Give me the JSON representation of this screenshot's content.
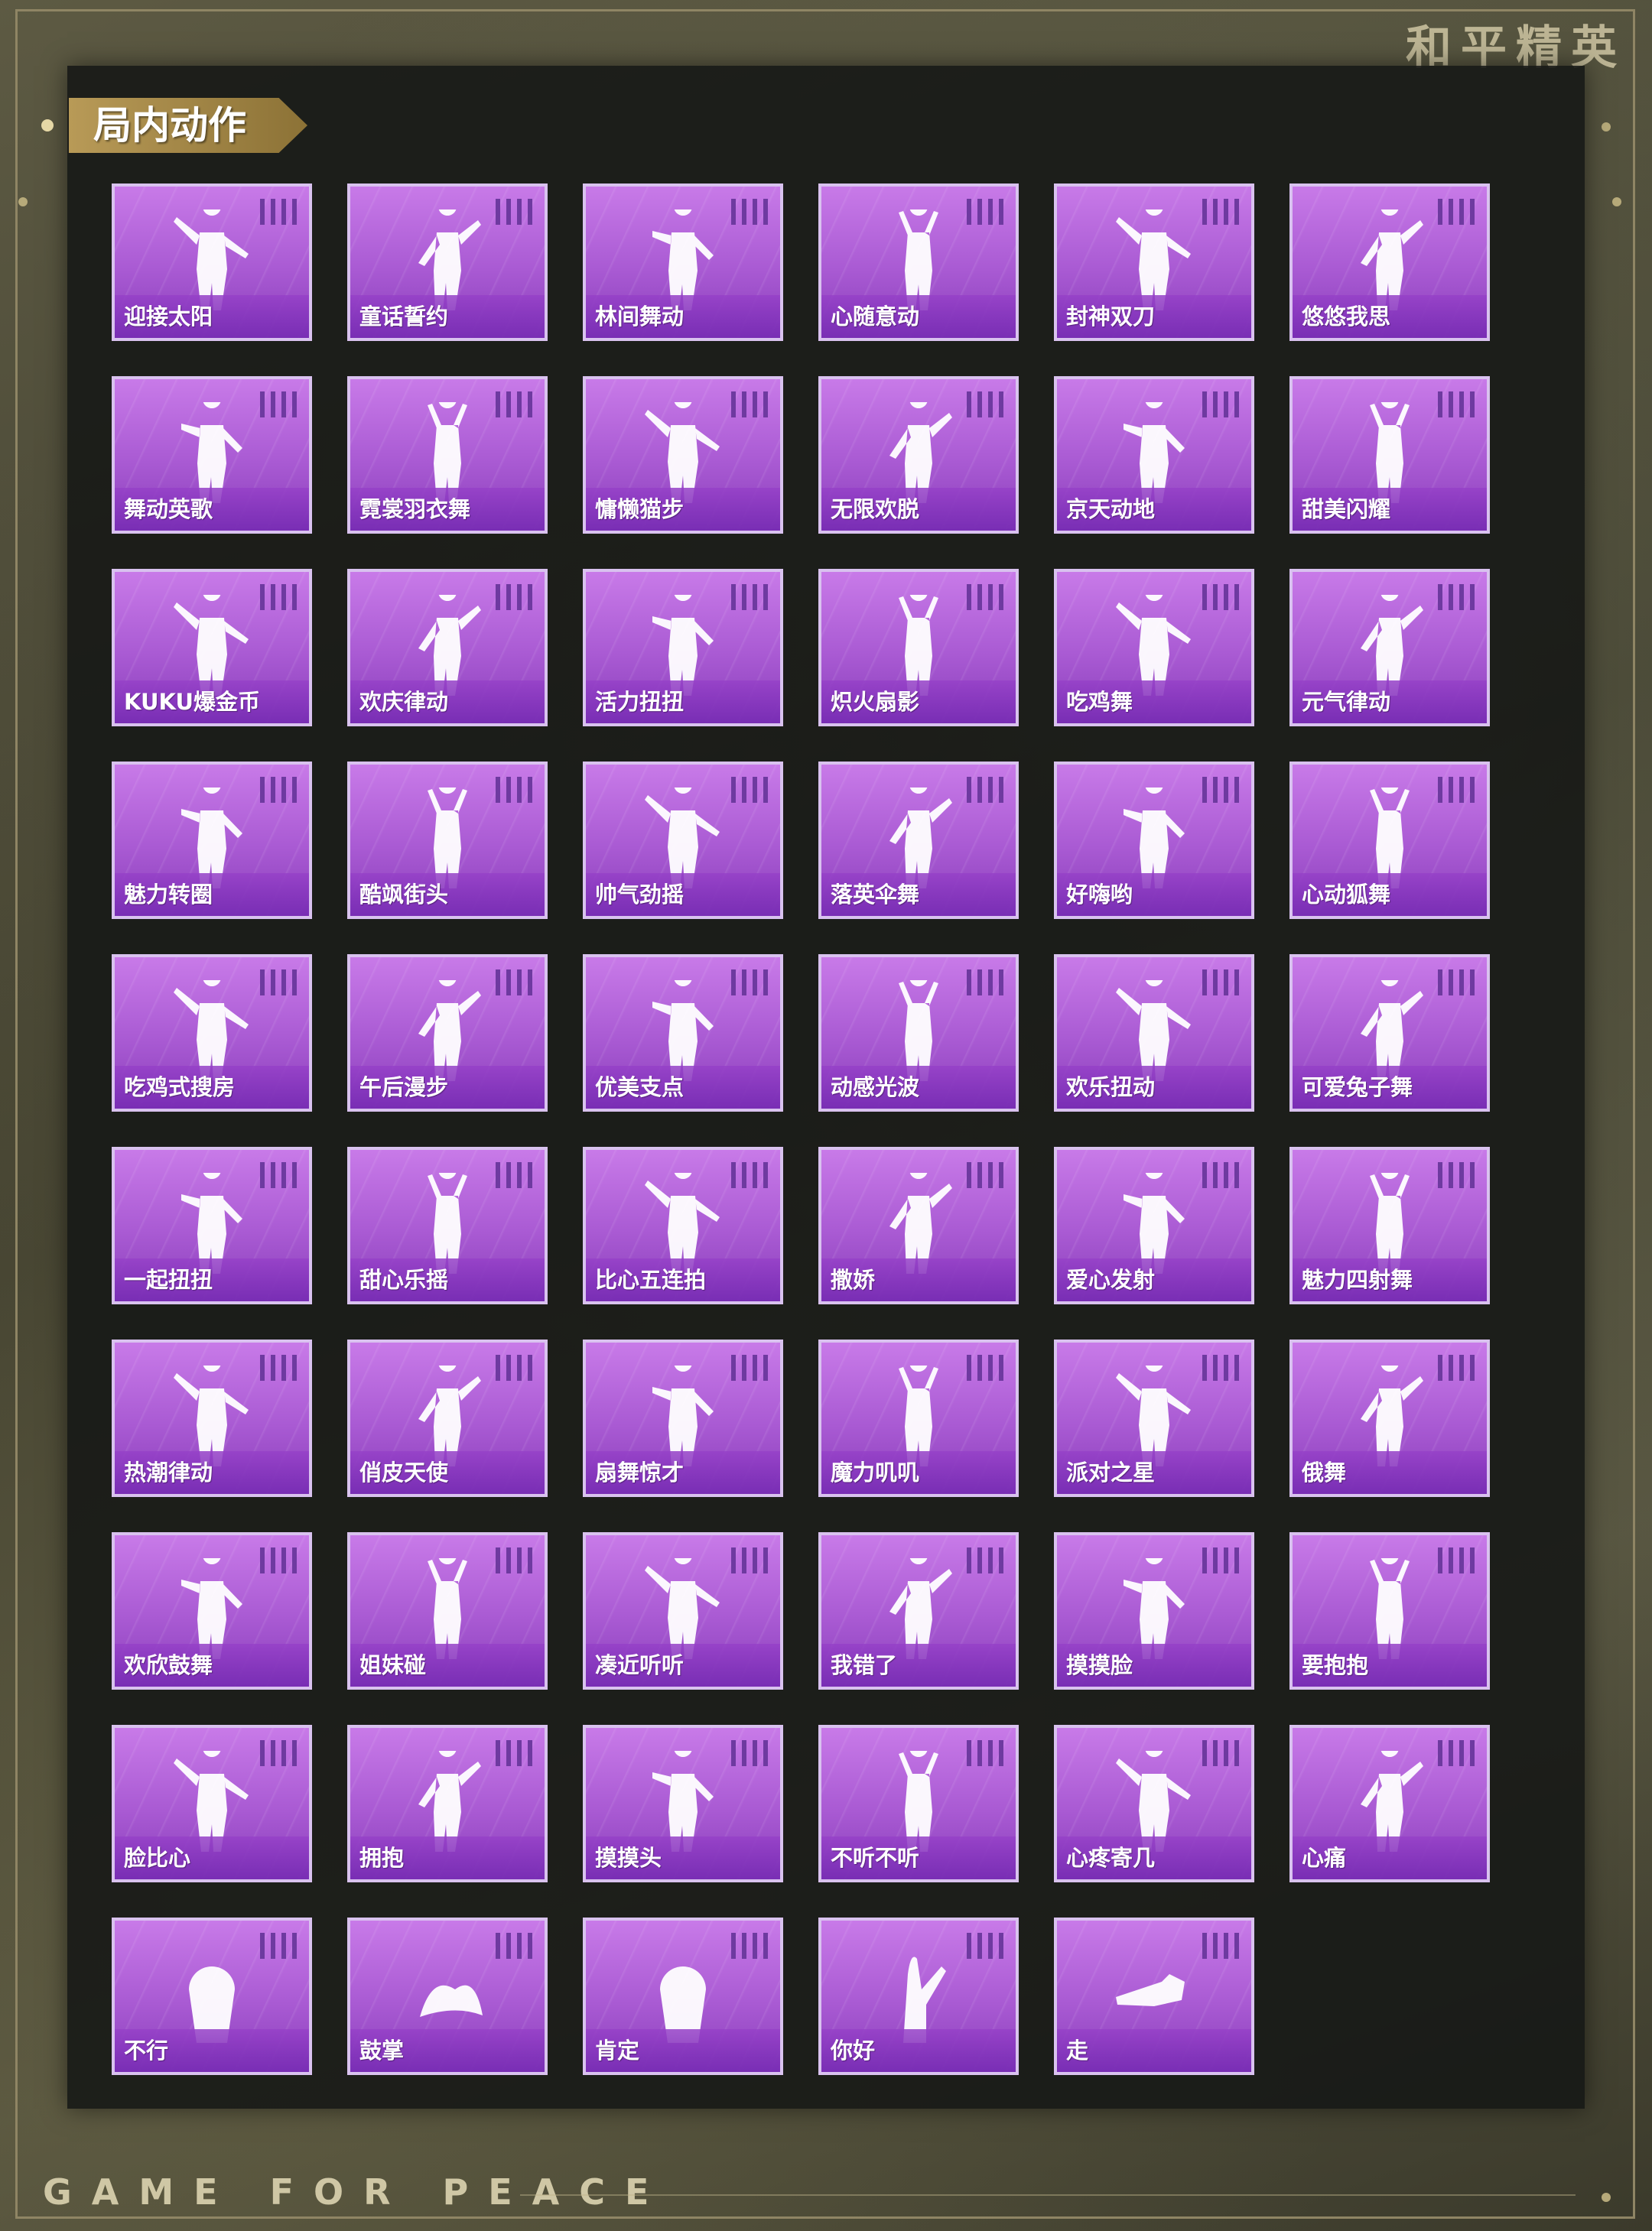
{
  "brand": {
    "logo_text": "和平精英"
  },
  "footer": {
    "slogan": "GAME FOR PEACE"
  },
  "section": {
    "title": "局内动作"
  },
  "emotes": [
    {
      "label": "迎接太阳",
      "icon": "dance-pose-icon"
    },
    {
      "label": "童话誓约",
      "icon": "dance-pose-icon"
    },
    {
      "label": "林间舞动",
      "icon": "dance-pose-icon"
    },
    {
      "label": "心随意动",
      "icon": "dance-pose-icon"
    },
    {
      "label": "封神双刀",
      "icon": "dance-pose-icon"
    },
    {
      "label": "悠悠我思",
      "icon": "dance-pose-icon"
    },
    {
      "label": "舞动英歌",
      "icon": "dance-pose-icon"
    },
    {
      "label": "霓裳羽衣舞",
      "icon": "dance-pose-icon"
    },
    {
      "label": "慵懒猫步",
      "icon": "dance-pose-icon"
    },
    {
      "label": "无限欢脱",
      "icon": "dance-pose-icon"
    },
    {
      "label": "京天动地",
      "icon": "dance-pose-icon"
    },
    {
      "label": "甜美闪耀",
      "icon": "dance-pose-icon"
    },
    {
      "label": "KUKU爆金币",
      "icon": "dance-pose-icon"
    },
    {
      "label": "欢庆律动",
      "icon": "dance-pose-icon"
    },
    {
      "label": "活力扭扭",
      "icon": "dance-pose-icon"
    },
    {
      "label": "炽火扇影",
      "icon": "dance-pose-icon"
    },
    {
      "label": "吃鸡舞",
      "icon": "dance-pose-icon"
    },
    {
      "label": "元气律动",
      "icon": "dance-pose-icon"
    },
    {
      "label": "魅力转圈",
      "icon": "dance-pose-icon"
    },
    {
      "label": "酷飒街头",
      "icon": "dance-pose-icon"
    },
    {
      "label": "帅气劲摇",
      "icon": "dance-pose-icon"
    },
    {
      "label": "落英伞舞",
      "icon": "dance-pose-icon"
    },
    {
      "label": "好嗨哟",
      "icon": "dance-pose-icon"
    },
    {
      "label": "心动狐舞",
      "icon": "dance-pose-icon"
    },
    {
      "label": "吃鸡式搜房",
      "icon": "dance-pose-icon"
    },
    {
      "label": "午后漫步",
      "icon": "dance-pose-icon"
    },
    {
      "label": "优美支点",
      "icon": "dance-pose-icon"
    },
    {
      "label": "动感光波",
      "icon": "dance-pose-icon"
    },
    {
      "label": "欢乐扭动",
      "icon": "dance-pose-icon"
    },
    {
      "label": "可爱兔子舞",
      "icon": "dance-pose-icon"
    },
    {
      "label": "一起扭扭",
      "icon": "dance-pose-icon"
    },
    {
      "label": "甜心乐摇",
      "icon": "dance-pose-icon"
    },
    {
      "label": "比心五连拍",
      "icon": "dance-pose-icon"
    },
    {
      "label": "撒娇",
      "icon": "dance-pose-icon"
    },
    {
      "label": "爱心发射",
      "icon": "dance-pose-icon"
    },
    {
      "label": "魅力四射舞",
      "icon": "dance-pose-icon"
    },
    {
      "label": "热潮律动",
      "icon": "dance-pose-icon"
    },
    {
      "label": "俏皮天使",
      "icon": "dance-pose-icon"
    },
    {
      "label": "扇舞惊才",
      "icon": "dance-pose-icon"
    },
    {
      "label": "魔力叽叽",
      "icon": "dance-pose-icon"
    },
    {
      "label": "派对之星",
      "icon": "dance-pose-icon"
    },
    {
      "label": "俄舞",
      "icon": "dance-pose-icon"
    },
    {
      "label": "欢欣鼓舞",
      "icon": "dance-pose-icon"
    },
    {
      "label": "姐妹碰",
      "icon": "dance-pose-icon"
    },
    {
      "label": "凑近听听",
      "icon": "dance-pose-icon"
    },
    {
      "label": "我错了",
      "icon": "dance-pose-icon"
    },
    {
      "label": "摸摸脸",
      "icon": "dance-pose-icon"
    },
    {
      "label": "要抱抱",
      "icon": "dance-pose-icon"
    },
    {
      "label": "脸比心",
      "icon": "dance-pose-icon"
    },
    {
      "label": "拥抱",
      "icon": "dance-pose-icon"
    },
    {
      "label": "摸摸头",
      "icon": "dance-pose-icon"
    },
    {
      "label": "不听不听",
      "icon": "dance-pose-icon"
    },
    {
      "label": "心疼寄几",
      "icon": "dance-pose-icon"
    },
    {
      "label": "心痛",
      "icon": "dance-pose-icon"
    },
    {
      "label": "不行",
      "icon": "head-shake-icon"
    },
    {
      "label": "鼓掌",
      "icon": "clapping-hands-icon"
    },
    {
      "label": "肯定",
      "icon": "head-nod-icon"
    },
    {
      "label": "你好",
      "icon": "waving-hand-icon"
    },
    {
      "label": "走",
      "icon": "pointing-hand-icon"
    }
  ]
}
